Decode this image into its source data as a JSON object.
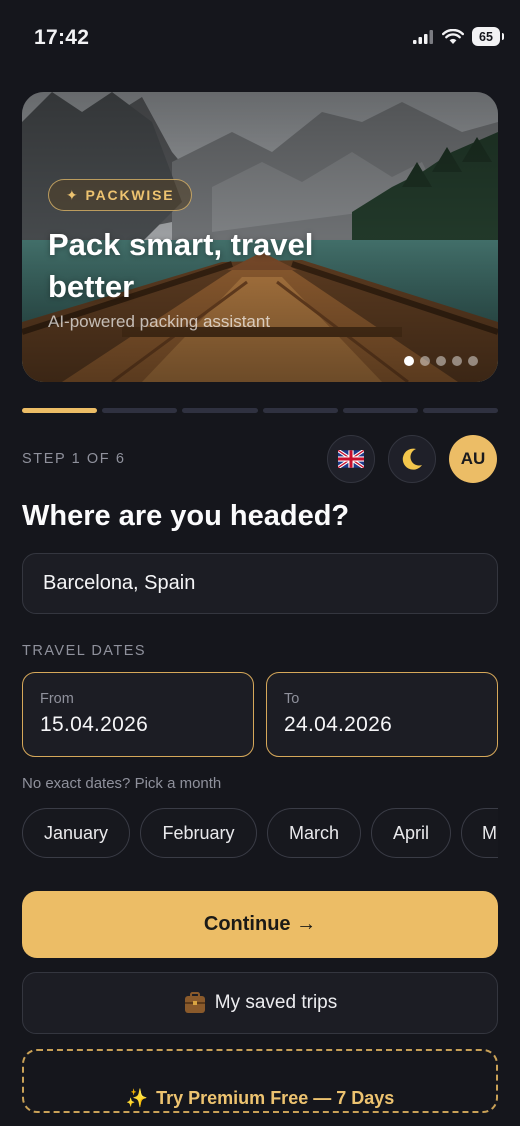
{
  "status": {
    "time": "17:42",
    "battery": "65"
  },
  "hero": {
    "badge": "PACKWISE",
    "title": "Pack smart, travel better",
    "subtitle": "AI-powered packing assistant",
    "slides_total": 5,
    "slide_active": 1
  },
  "progress": {
    "total_steps": 6,
    "current_step": 1,
    "accent_color": "#ecbd66"
  },
  "header": {
    "step_label": "STEP 1 OF 6",
    "language_icon": "uk-flag-icon",
    "theme_icon": "moon-icon",
    "avatar_initials": "AU"
  },
  "form": {
    "title": "Where are you headed?",
    "destination_value": "Barcelona, Spain",
    "dates_label": "TRAVEL DATES",
    "from_label": "From",
    "from_value": "15.04.2026",
    "to_label": "To",
    "to_value": "24.04.2026",
    "month_hint": "No exact dates? Pick a month",
    "months": [
      "January",
      "February",
      "March",
      "April",
      "M"
    ]
  },
  "actions": {
    "continue_label": "Continue →",
    "saved_trips_label": "My saved trips",
    "saved_trips_icon": "suitcase-icon",
    "premium_label": "Try Premium Free — 7 Days",
    "premium_icon": "sparkles-icon"
  }
}
